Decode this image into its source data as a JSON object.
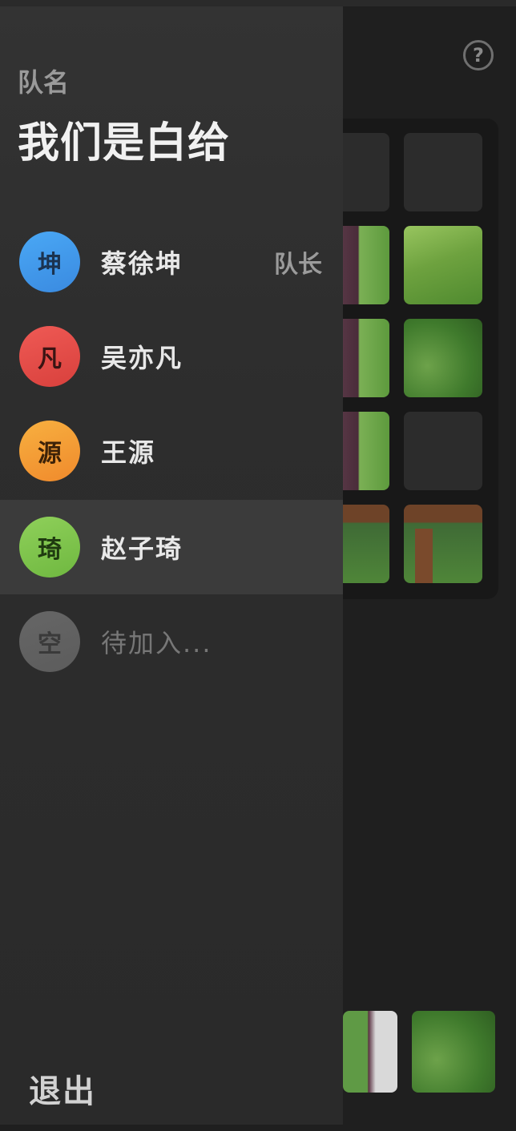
{
  "help": {
    "icon": "help-icon",
    "glyph": "?"
  },
  "drawer": {
    "team_label": "队名",
    "team_name": "我们是白给",
    "members": [
      {
        "avatar_text": "坤",
        "name": "蔡徐坤",
        "role": "队长",
        "color_from": "#4aa8f5",
        "color_to": "#3a8ae0",
        "text_color": "#1b3350"
      },
      {
        "avatar_text": "凡",
        "name": "吴亦凡",
        "role": "",
        "color_from": "#ef5a55",
        "color_to": "#d8403c",
        "text_color": "#3a1413"
      },
      {
        "avatar_text": "源",
        "name": "王源",
        "role": "",
        "color_from": "#f7b040",
        "color_to": "#f08a2c",
        "text_color": "#3d2208"
      },
      {
        "avatar_text": "琦",
        "name": "赵子琦",
        "role": "",
        "color_from": "#8fd05a",
        "color_to": "#6fb840",
        "text_color": "#1f3a10"
      },
      {
        "avatar_text": "空",
        "name": "待加入...",
        "role": "",
        "color_from": "#666666",
        "color_to": "#5c5c5c",
        "text_color": "#3a3a3a"
      }
    ],
    "exit_label": "退出"
  }
}
